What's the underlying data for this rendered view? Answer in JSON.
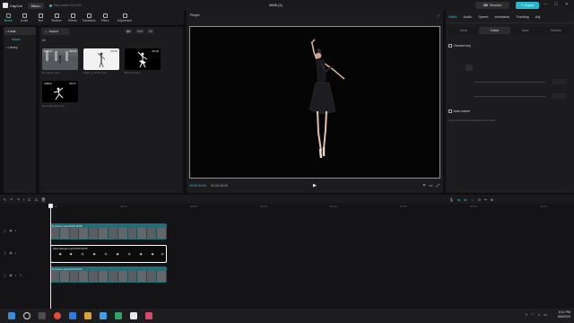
{
  "titlebar": {
    "app_name": "CapCut",
    "menu_label": "Menu",
    "autosave_text": "Auto saved: 20:11:03",
    "project_title": "0606 (1)",
    "shortcut_label": "Shortcut",
    "export_label": "Export",
    "window_controls": [
      "—",
      "☐",
      "✕"
    ]
  },
  "media_tools": [
    {
      "label": "Media",
      "icon": "media-icon",
      "active": true
    },
    {
      "label": "Audio",
      "icon": "audio-icon"
    },
    {
      "label": "Text",
      "icon": "text-icon"
    },
    {
      "label": "Stickers",
      "icon": "stickers-icon"
    },
    {
      "label": "Effects",
      "icon": "effects-icon"
    },
    {
      "label": "Transitions",
      "icon": "transitions-icon"
    },
    {
      "label": "Filters",
      "icon": "filters-icon"
    },
    {
      "label": "Adjustment",
      "icon": "adjustment-icon"
    }
  ],
  "sidebar": {
    "local": "• Local",
    "import": "Import",
    "library": "• Library"
  },
  "media": {
    "import_label": "Import",
    "all_label": "All",
    "sort_label": "Sort",
    "all_filter_label": "All",
    "items": [
      {
        "name": "B_Dance.mp4",
        "duration": "00:19",
        "added": "Added"
      },
      {
        "name": "ballet_g..8715.mp4",
        "duration": "00:16",
        "added": ""
      },
      {
        "name": "Bird (3).mp4",
        "duration": "00:16",
        "added": ""
      },
      {
        "name": "Glow Sample.mp4",
        "duration": "00:17",
        "added": "Added"
      }
    ]
  },
  "player": {
    "title": "Player",
    "current_time": "00:00:00:00",
    "total_time": "00:00:16:20"
  },
  "inspector": {
    "tabs": [
      "Video",
      "Audio",
      "Speed",
      "Animation",
      "Tracking",
      "Adj"
    ],
    "subtabs": [
      "Basic",
      "Cutout",
      "Mask",
      "Enhance"
    ],
    "active_subtab": 1,
    "chroma_key_label": "Chroma key",
    "auto_cutout_label": "Auto cutout",
    "note": "Only supports auto recognition of portraits"
  },
  "timeline": {
    "ticks": [
      "00:00",
      "00:10",
      "00:20",
      "00:30",
      "00:40",
      "00:50",
      "01:00",
      "01:10"
    ],
    "tracks": [
      {
        "label": "B_Dance.mp4   00:00:18:18"
      },
      {
        "label": "Glow Sample.mp4   00:00:16:20"
      },
      {
        "label": "B_Dance.mp4   00:00:16:19"
      }
    ]
  },
  "taskbar": {
    "time": "8:11 PM",
    "date": "6/6/2023"
  },
  "colors": {
    "accent": "#23b8cc",
    "clip_teal": "#1e6f78"
  }
}
